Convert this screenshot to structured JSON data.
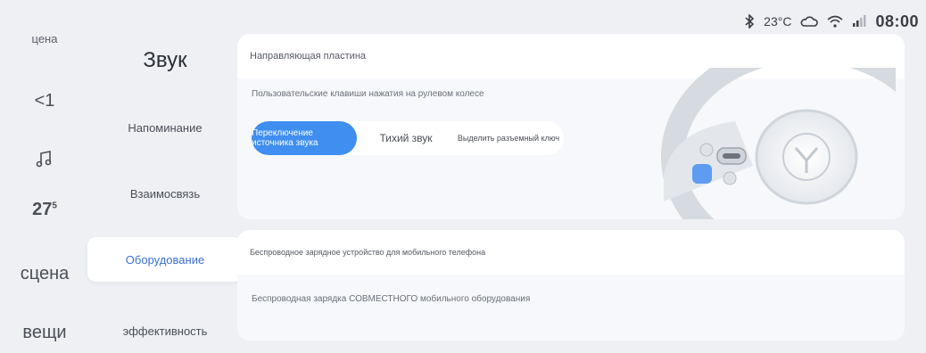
{
  "status_bar": {
    "temperature": "23°C",
    "time": "08:00",
    "icons": [
      "bluetooth-icon",
      "cloud-icon",
      "wifi-icon",
      "signal-icon"
    ]
  },
  "rail": {
    "items": [
      "цена",
      "<1",
      "",
      "27",
      "сцена",
      "вещи"
    ],
    "temp_superscript": "5"
  },
  "submenu": {
    "title": "Звук",
    "items": [
      {
        "label": "Напоминание",
        "active": false
      },
      {
        "label": "Взаимосвязь",
        "active": false
      },
      {
        "label": "Оборудование",
        "active": true
      },
      {
        "label": "эффективность",
        "active": false
      }
    ]
  },
  "card1": {
    "header": "Направляющая пластина",
    "description": "Пользовательские клавиши нажатия на рулевом колесе",
    "options": [
      {
        "label": "Переключение источника звука",
        "active": true
      },
      {
        "label": "Тихий звук",
        "active": false
      },
      {
        "label": "Выделить разъемный ключ",
        "active": false
      }
    ]
  },
  "card2": {
    "header": "Беспроводное зарядное устройство для мобильного телефона",
    "description": "Беспроводная зарядка СОВМЕСТНОГО мобильного оборудования"
  },
  "colors": {
    "accent": "#3f8ef0",
    "active_text": "#3b6fd6",
    "background": "#eef0f4"
  }
}
